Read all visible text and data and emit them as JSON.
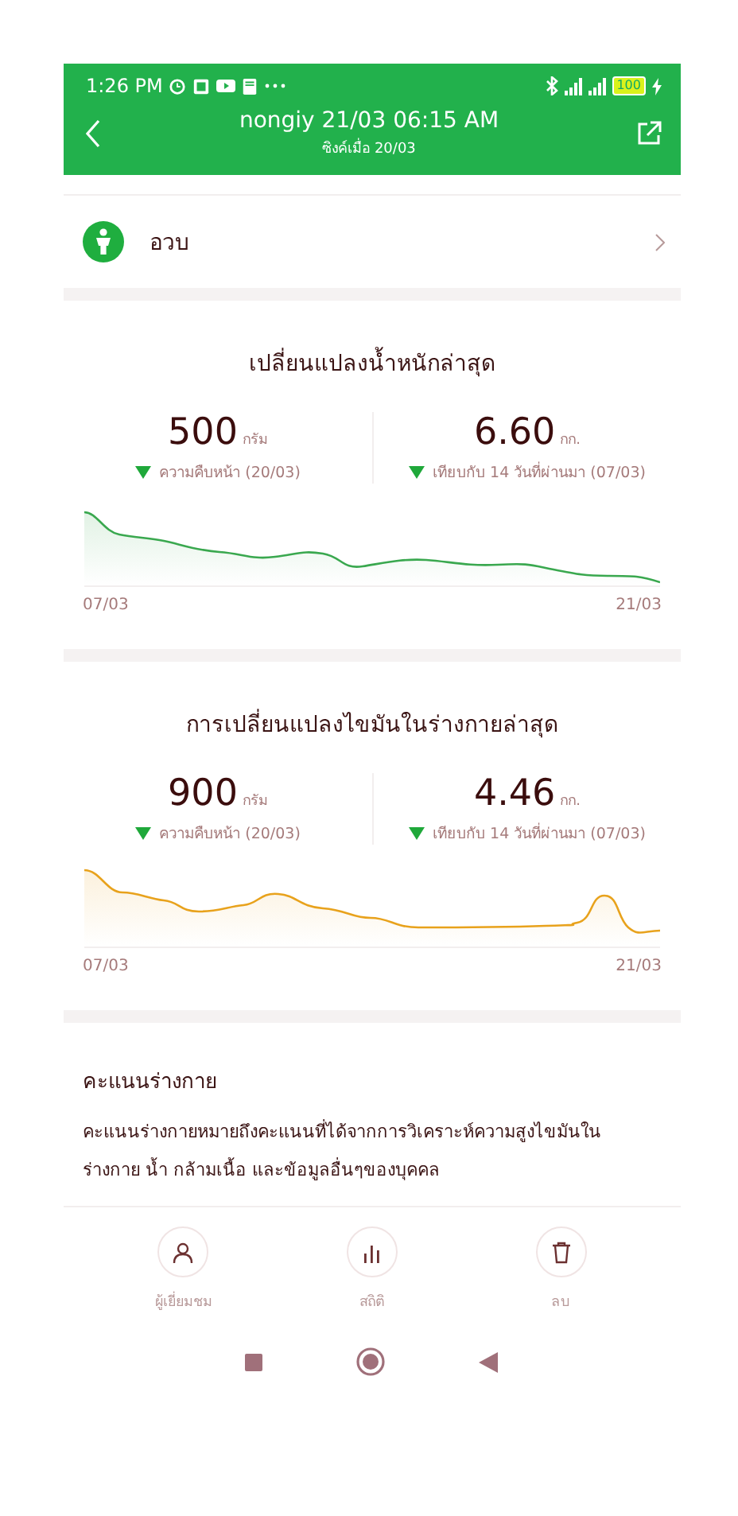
{
  "status_bar": {
    "time": "1:26 PM",
    "battery": "100"
  },
  "header": {
    "title": "nongiy 21/03 06:15 AM",
    "subtitle": "ซิงค์เมื่อ 20/03"
  },
  "profile_row": {
    "label": "อวบ"
  },
  "sections": [
    {
      "title": "เปลี่ยนแปลงน้ำหนักล่าสุด",
      "color": "#3aa84f",
      "stats": [
        {
          "value": "500",
          "unit": "กรัม",
          "decreased": true,
          "note": "ความคืบหน้า (20/03)"
        },
        {
          "value": "6.60",
          "unit": "กก.",
          "decreased": true,
          "note": "เทียบกับ 14 วันที่ผ่านมา (07/03)"
        }
      ],
      "x_start": "07/03",
      "x_end": "21/03"
    },
    {
      "title": "การเปลี่ยนแปลงไขมันในร่างกายล่าสุด",
      "color": "#e8a21c",
      "stats": [
        {
          "value": "900",
          "unit": "กรัม",
          "decreased": true,
          "note": "ความคืบหน้า (20/03)"
        },
        {
          "value": "4.46",
          "unit": "กก.",
          "decreased": true,
          "note": "เทียบกับ 14 วันที่ผ่านมา (07/03)"
        }
      ],
      "x_start": "07/03",
      "x_end": "21/03"
    }
  ],
  "body_score": {
    "title": "คะแนนร่างกาย",
    "text": "คะแนนร่างกายหมายถึงคะแนนที่ได้จากการวิเคราะห์ความสูงไขมันในร่างกาย น้ำ กล้ามเนื้อ และข้อมูลอื่นๆของบุคคล"
  },
  "actions": [
    {
      "kind": "visitor",
      "label": "ผู้เยี่ยมชม"
    },
    {
      "kind": "stats",
      "label": "สถิติ"
    },
    {
      "kind": "delete",
      "label": "ลบ"
    }
  ]
}
